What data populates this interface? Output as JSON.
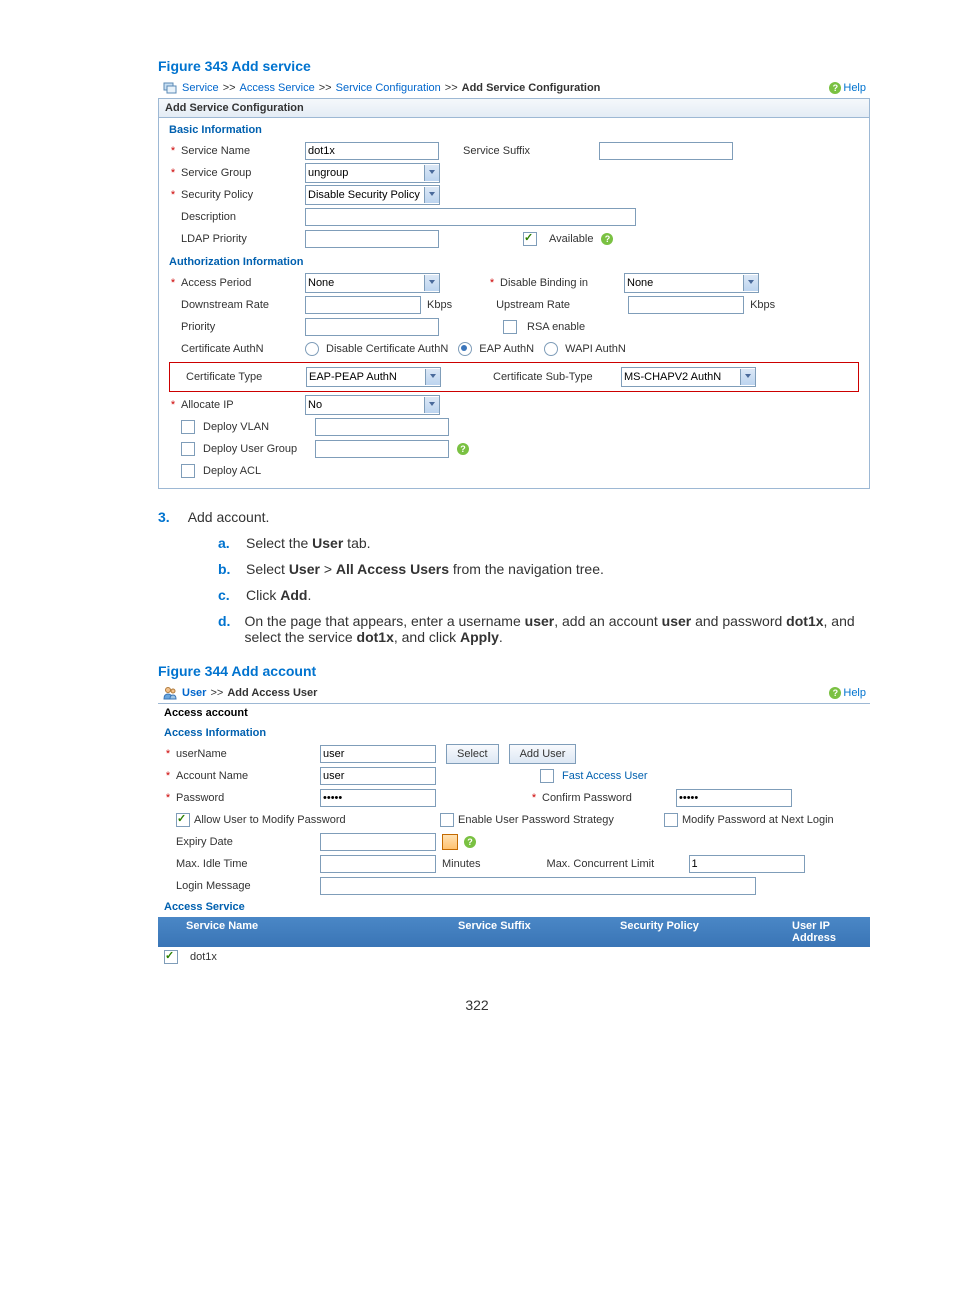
{
  "figure343": {
    "title": "Figure 343 Add service",
    "breadcrumb": {
      "items": [
        "Service",
        "Access Service",
        "Service Configuration",
        "Add Service Configuration"
      ],
      "sep": ">>"
    },
    "help_label": "Help",
    "panel_title": "Add Service Configuration",
    "basic_info_title": "Basic Information",
    "auth_info_title": "Authorization Information",
    "labels": {
      "service_name": "Service Name",
      "service_group": "Service Group",
      "security_policy": "Security Policy",
      "description": "Description",
      "ldap_priority": "LDAP Priority",
      "service_suffix": "Service Suffix",
      "available": "Available",
      "access_period": "Access Period",
      "downstream_rate": "Downstream Rate",
      "priority": "Priority",
      "certificate_authn": "Certificate AuthN",
      "certificate_type": "Certificate Type",
      "allocate_ip": "Allocate IP",
      "deploy_vlan": "Deploy VLAN",
      "deploy_user_group": "Deploy User Group",
      "deploy_acl": "Deploy ACL",
      "disable_binding_in": "Disable Binding in",
      "upstream_rate": "Upstream Rate",
      "rsa_enable": "RSA enable",
      "certificate_sub_type": "Certificate Sub-Type",
      "kbps": "Kbps"
    },
    "values": {
      "service_name": "dot1x",
      "service_group": "ungroup",
      "security_policy": "Disable Security Policy",
      "access_period": "None",
      "disable_binding_in": "None",
      "cert_opt_disable": "Disable Certificate AuthN",
      "cert_opt_eap": "EAP AuthN",
      "cert_opt_wapi": "WAPI AuthN",
      "certificate_type": "EAP-PEAP AuthN",
      "certificate_sub_type": "MS-CHAPV2 AuthN",
      "allocate_ip": "No"
    }
  },
  "instructions": {
    "step_num": "3.",
    "step_text": "Add account.",
    "substeps": [
      {
        "letter": "a.",
        "parts": [
          "Select the ",
          "User",
          " tab."
        ]
      },
      {
        "letter": "b.",
        "parts": [
          "Select ",
          "User",
          " > ",
          "All Access Users",
          " from the navigation tree."
        ]
      },
      {
        "letter": "c.",
        "parts": [
          "Click ",
          "Add",
          "."
        ]
      },
      {
        "letter": "d.",
        "parts": [
          "On the page that appears, enter a username ",
          "user",
          ", add an account ",
          "user",
          " and password ",
          "dot1x",
          ", and select the service ",
          "dot1x",
          ", and click ",
          "Apply",
          "."
        ]
      }
    ]
  },
  "figure344": {
    "title": "Figure 344 Add account",
    "breadcrumb": {
      "items": [
        "User",
        "Add Access User"
      ],
      "sep": ">>"
    },
    "help_label": "Help",
    "panel_title": "Access account",
    "section1_title": "Access Information",
    "section2_title": "Access Service",
    "labels": {
      "username": "userName",
      "account_name": "Account Name",
      "password": "Password",
      "allow_modify": "Allow User to Modify Password",
      "enable_pw_strategy": "Enable User Password Strategy",
      "modify_next_login": "Modify Password at Next Login",
      "expiry_date": "Expiry Date",
      "max_idle": "Max. Idle Time",
      "login_message": "Login Message",
      "select_btn": "Select",
      "add_user_btn": "Add User",
      "fast_access_user": "Fast Access User",
      "confirm_password": "Confirm Password",
      "minutes": "Minutes",
      "max_concurrent": "Max. Concurrent Limit"
    },
    "values": {
      "username": "user",
      "account_name": "user",
      "password": "•••••",
      "confirm_password": "•••••",
      "max_concurrent": "1"
    },
    "table": {
      "headers": [
        "Service Name",
        "Service Suffix",
        "Security Policy",
        "User IP Address"
      ],
      "row0_name": "dot1x"
    }
  },
  "page_number": "322"
}
